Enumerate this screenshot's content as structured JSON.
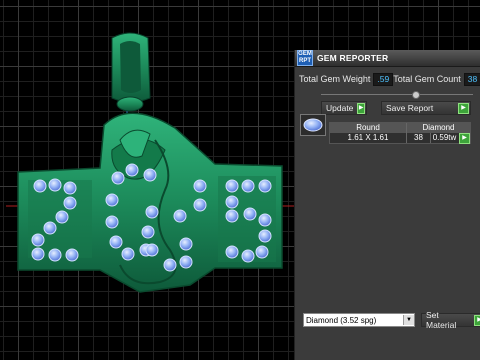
{
  "window": {
    "title": "GEM REPORTER",
    "app_icon": "gem-reporter-icon"
  },
  "totals": {
    "weight_label": "Total Gem Weight",
    "weight_value": ".59",
    "count_label": "Total Gem Count",
    "count_value": "38"
  },
  "actions": {
    "update_label": "Update",
    "save_label": "Save Report"
  },
  "table": {
    "headers": [
      "Round",
      "Diamond"
    ],
    "rows": [
      {
        "size": "1.61 X 1.61",
        "count": "38",
        "weight": "0.59tw"
      }
    ]
  },
  "material": {
    "selected": "Diamond    (3.52 spg)",
    "set_label": "Set Material"
  },
  "colors": {
    "metal": "#1f8a5a",
    "gem": "#8fb0f5",
    "accent": "#4fc3ff",
    "go_button": "#3da43a"
  }
}
